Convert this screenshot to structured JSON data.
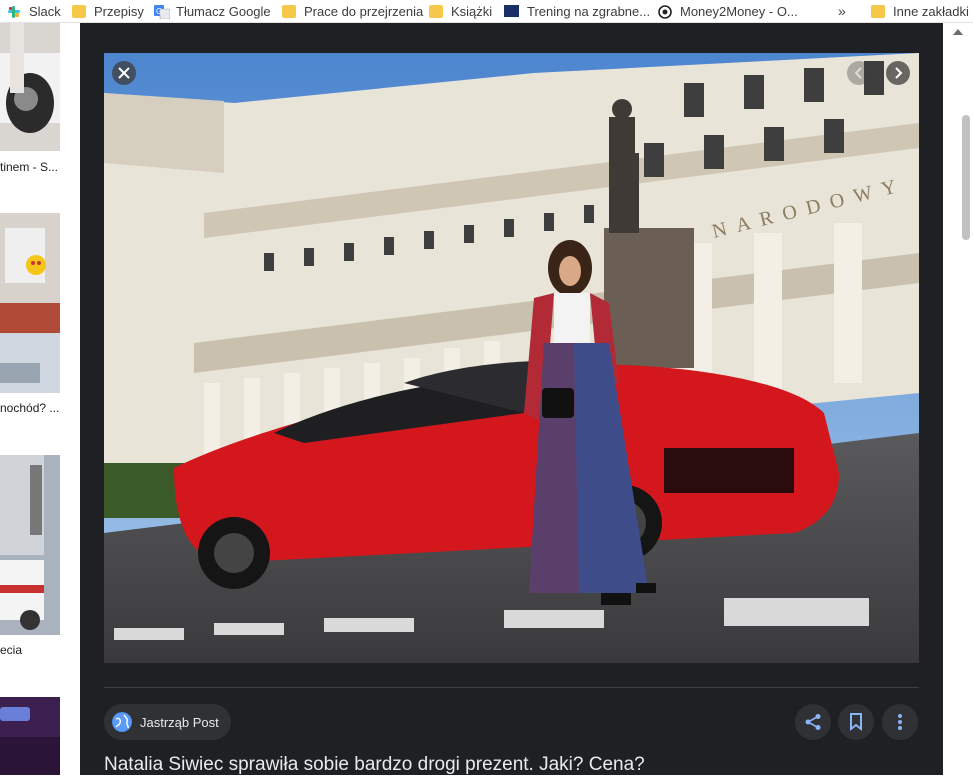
{
  "bookmarks": [
    {
      "label": "Slack",
      "icon": "slack-icon"
    },
    {
      "label": "Przepisy",
      "icon": "folder-icon"
    },
    {
      "label": "Tłumacz Google",
      "icon": "google-translate-icon"
    },
    {
      "label": "Prace do przejrzenia",
      "icon": "folder-icon"
    },
    {
      "label": "Książki",
      "icon": "folder-icon"
    },
    {
      "label": "Trening na zgrabne...",
      "icon": "sfd-icon"
    },
    {
      "label": "Money2Money - O...",
      "icon": "money2money-icon"
    },
    {
      "label": "»",
      "icon": "more-bookmarks-icon"
    },
    {
      "label": "Inne zakładki",
      "icon": "folder-icon"
    }
  ],
  "results": [
    {
      "caption": "tinem - S..."
    },
    {
      "caption": "nochód? ..."
    },
    {
      "caption": "ecia"
    }
  ],
  "viewer": {
    "source": "Jastrząb Post",
    "headline": "Natalia Siwiec sprawiła sobie bardzo drogi prezent. Jaki? Cena?",
    "photo_sign_text": "NARODOWY"
  },
  "colors": {
    "panel_bg": "#1f2023",
    "chip_bg": "#303134",
    "text_light": "#e8eaed",
    "link_blue": "#8ab4f8"
  }
}
